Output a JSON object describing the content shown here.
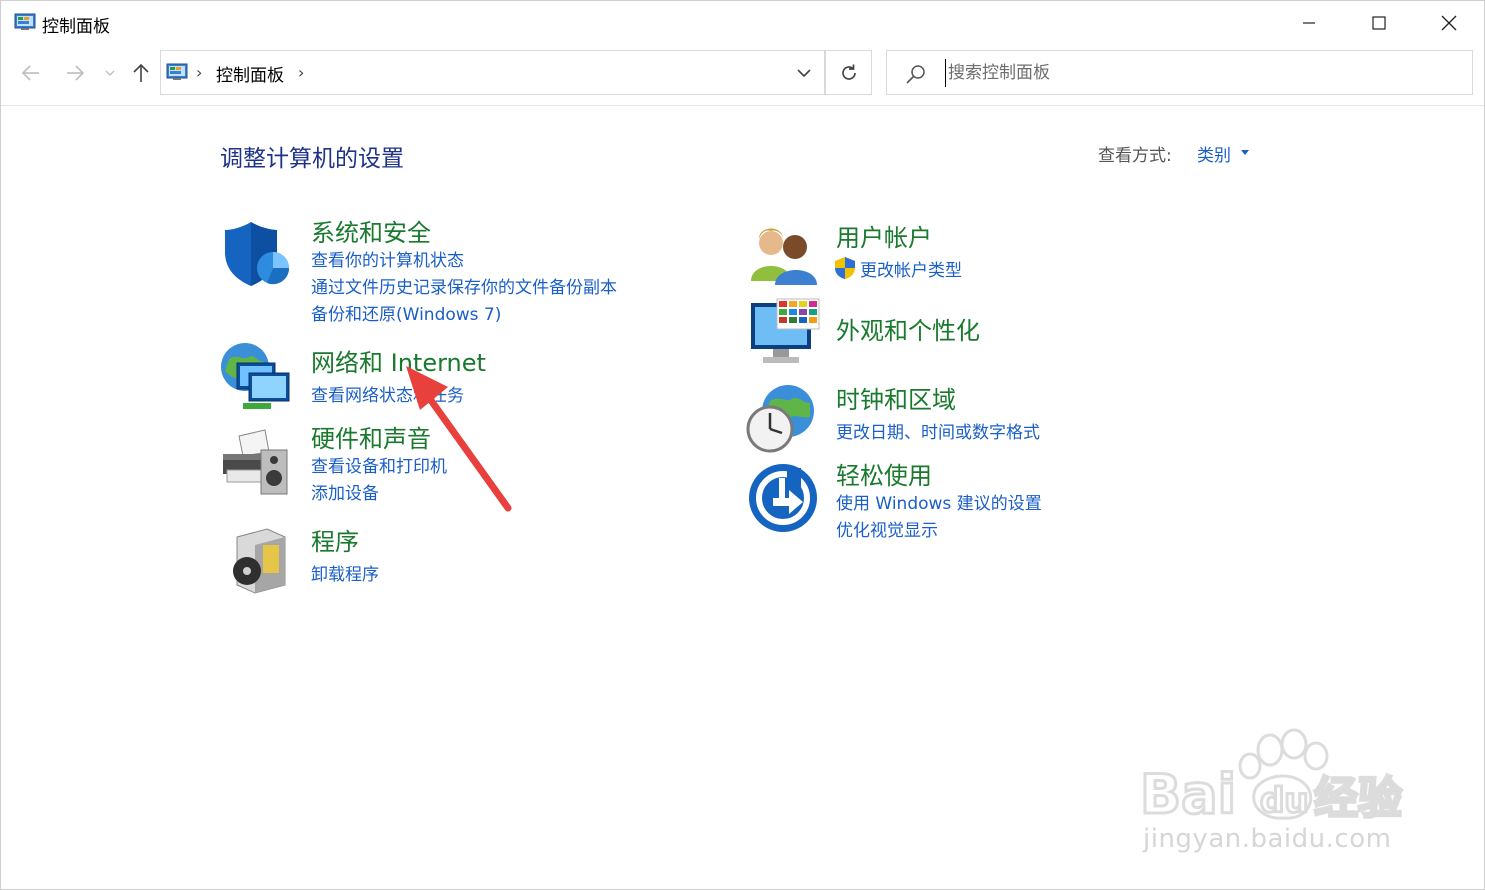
{
  "window": {
    "title": "控制面板"
  },
  "nav": {
    "breadcrumb": "控制面板",
    "search_placeholder": "搜索控制面板"
  },
  "content": {
    "heading": "调整计算机的设置",
    "view_by_label": "查看方式:",
    "view_by_value": "类别"
  },
  "categories": [
    {
      "title": "系统和安全",
      "icon": "security-shield-icon",
      "links": [
        "查看你的计算机状态",
        "通过文件历史记录保存你的文件备份副本",
        "备份和还原(Windows 7)"
      ]
    },
    {
      "title": "网络和 Internet",
      "icon": "network-globe-icon",
      "links": [
        "查看网络状态和任务"
      ]
    },
    {
      "title": "硬件和声音",
      "icon": "printer-speaker-icon",
      "links": [
        "查看设备和打印机",
        "添加设备"
      ]
    },
    {
      "title": "程序",
      "icon": "programs-box-icon",
      "links": [
        "卸载程序"
      ]
    },
    {
      "title": "用户帐户",
      "icon": "user-accounts-icon",
      "links": [
        "更改帐户类型"
      ]
    },
    {
      "title": "外观和个性化",
      "icon": "monitor-color-icon",
      "links": []
    },
    {
      "title": "时钟和区域",
      "icon": "clock-globe-icon",
      "links": [
        "更改日期、时间或数字格式"
      ]
    },
    {
      "title": "轻松使用",
      "icon": "ease-of-access-icon",
      "links": [
        "使用 Windows 建议的设置",
        "优化视觉显示"
      ]
    }
  ],
  "watermark": {
    "brand": "Bai du 经验",
    "url": "jingyan.baidu.com"
  },
  "colors": {
    "category_title": "#197a2e",
    "link": "#1a5fc8",
    "heading": "#1e3287",
    "annotation_arrow": "#e8403c"
  }
}
